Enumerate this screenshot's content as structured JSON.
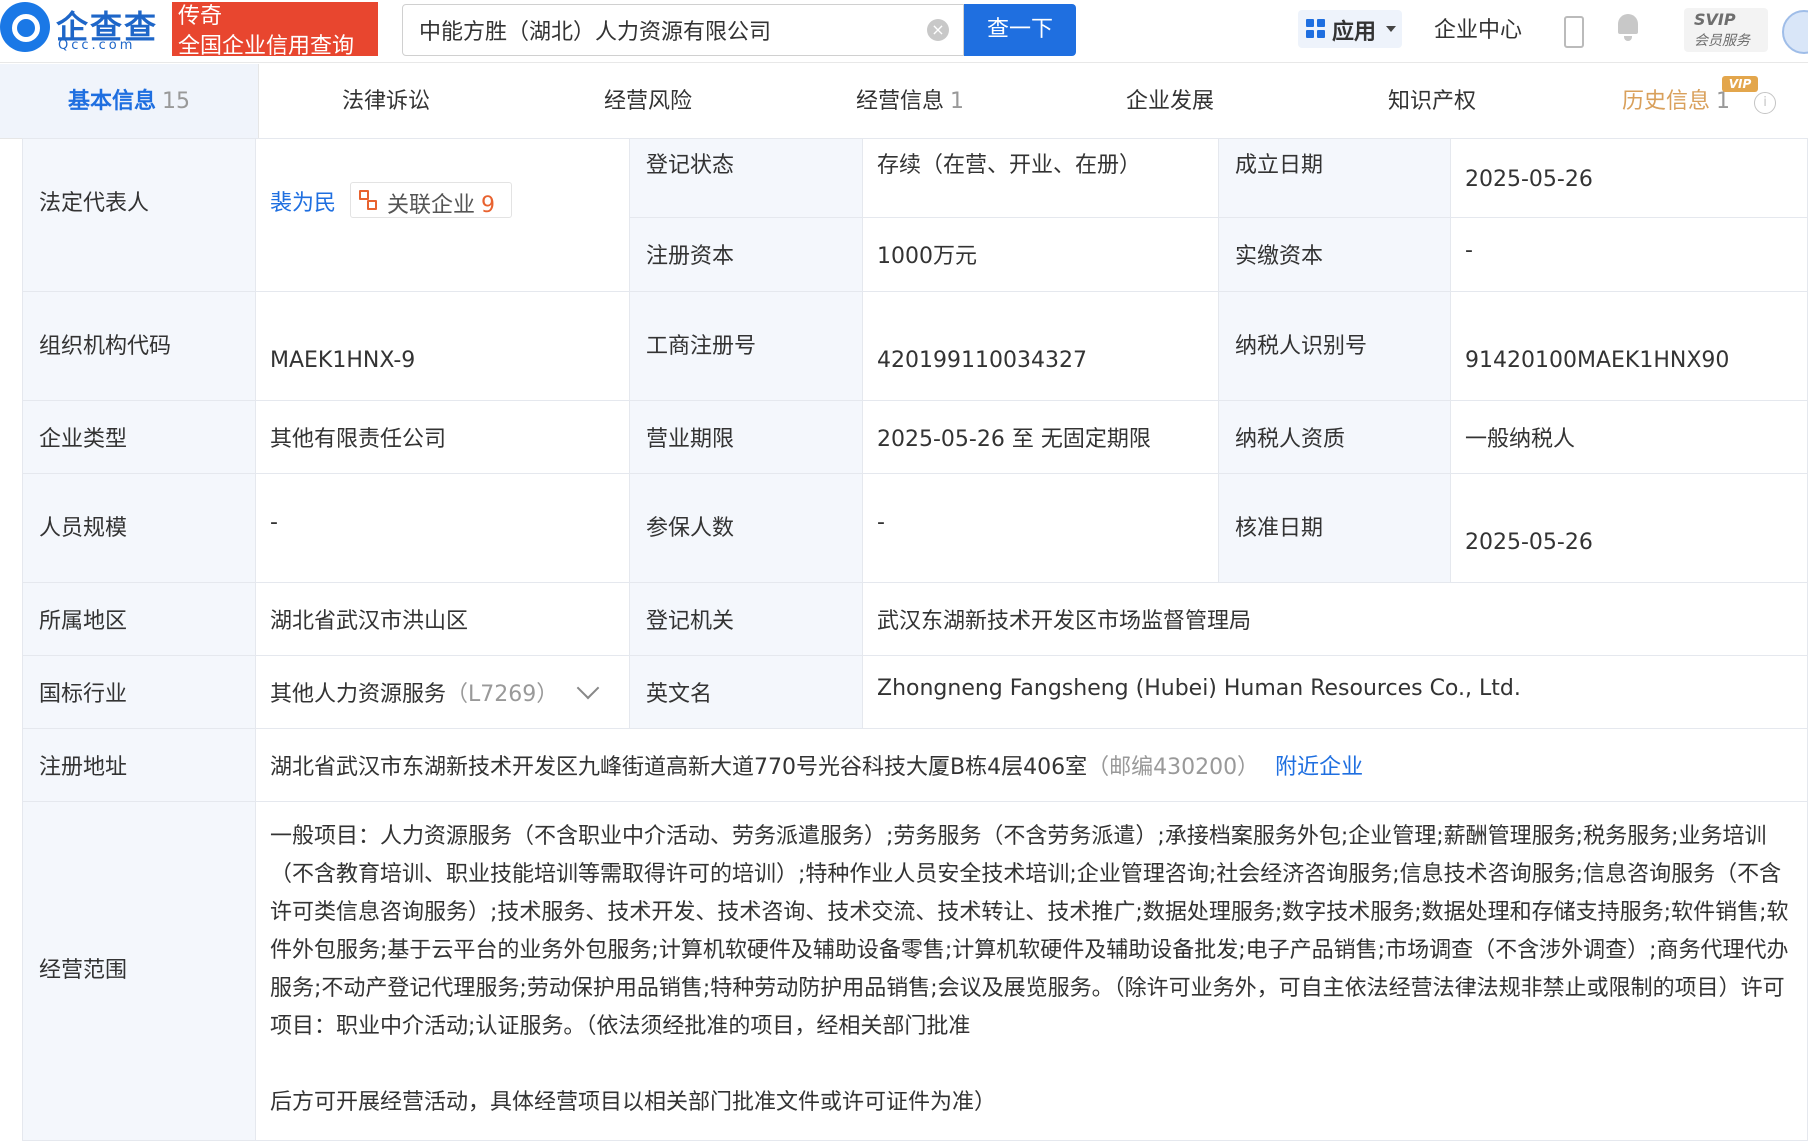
{
  "header": {
    "logo_text": "企查查",
    "logo_sub": "Qcc.com",
    "legend_line1": "传奇",
    "legend_line2": "全国企业信用查询",
    "search_value": "中能方胜（湖北）人力资源有限公司",
    "search_button": "查一下",
    "apps_label": "应用",
    "enterprise_center": "企业中心",
    "svip_line1": "SVIP",
    "svip_line2": "会员服务"
  },
  "tabs": [
    {
      "label": "基本信息",
      "count": "15"
    },
    {
      "label": "法律诉讼",
      "count": ""
    },
    {
      "label": "经营风险",
      "count": ""
    },
    {
      "label": "经营信息",
      "count": "1"
    },
    {
      "label": "企业发展",
      "count": ""
    },
    {
      "label": "知识产权",
      "count": ""
    },
    {
      "label": "历史信息",
      "count": "1",
      "badge": "VIP"
    }
  ],
  "info": {
    "legal_rep_label": "法定代表人",
    "legal_rep_name": "裴为民",
    "assoc_label": "关联企业",
    "assoc_count": "9",
    "reg_status_label": "登记状态",
    "reg_status": "存续（在营、开业、在册）",
    "established_label": "成立日期",
    "established": "2025-05-26",
    "reg_capital_label": "注册资本",
    "reg_capital": "1000万元",
    "paid_capital_label": "实缴资本",
    "paid_capital": "-",
    "org_code_label": "组织机构代码",
    "org_code": "MAEK1HNX-9",
    "biz_reg_no_label": "工商注册号",
    "biz_reg_no": "420199110034327",
    "taxpayer_id_label": "纳税人识别号",
    "taxpayer_id": "91420100MAEK1HNX90",
    "ent_type_label": "企业类型",
    "ent_type": "其他有限责任公司",
    "biz_term_label": "营业期限",
    "biz_term": "2025-05-26 至 无固定期限",
    "taxpayer_qual_label": "纳税人资质",
    "taxpayer_qual": "一般纳税人",
    "staff_size_label": "人员规模",
    "staff_size": "-",
    "insured_label": "参保人数",
    "insured": "-",
    "approval_date_label": "核准日期",
    "approval_date": "2025-05-26",
    "region_label": "所属地区",
    "region": "湖北省武汉市洪山区",
    "reg_authority_label": "登记机关",
    "reg_authority": "武汉东湖新技术开发区市场监督管理局",
    "industry_label": "国标行业",
    "industry": "其他人力资源服务",
    "industry_code": "（L7269）",
    "english_name_label": "英文名",
    "english_name": "Zhongneng Fangsheng (Hubei) Human Resources Co., Ltd.",
    "address_label": "注册地址",
    "address": "湖北省武汉市东湖新技术开发区九峰街道高新大道770号光谷科技大厦B栋4层406室",
    "postcode": "（邮编430200）",
    "nearby": "附近企业",
    "scope_label": "经营范围",
    "scope": "一般项目：人力资源服务（不含职业中介活动、劳务派遣服务）;劳务服务（不含劳务派遣）;承接档案服务外包;企业管理;薪酬管理服务;税务服务;业务培训（不含教育培训、职业技能培训等需取得许可的培训）;特种作业人员安全技术培训;企业管理咨询;社会经济咨询服务;信息技术咨询服务;信息咨询服务（不含许可类信息咨询服务）;技术服务、技术开发、技术咨询、技术交流、技术转让、技术推广;数据处理服务;数字技术服务;数据处理和存储支持服务;软件销售;软件外包服务;基于云平台的业务外包服务;计算机软硬件及辅助设备零售;计算机软硬件及辅助设备批发;电子产品销售;市场调查（不含涉外调查）;商务代理代办服务;不动产登记代理服务;劳动保护用品销售;特种劳动防护用品销售;会议及展览服务。（除许可业务外，可自主依法经营法律法规非禁止或限制的项目）许可项目：职业中介活动;认证服务。（依法须经批准的项目，经相关部门批准",
    "scope_tail": "后方可开展经营活动，具体经营项目以相关部门批准文件或许可证件为准）"
  }
}
